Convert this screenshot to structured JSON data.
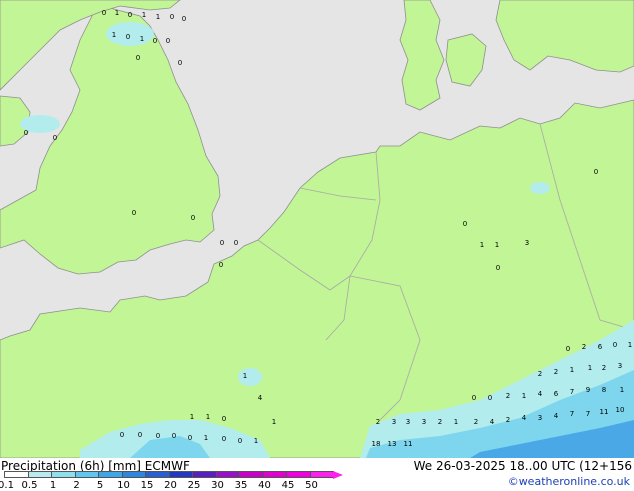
{
  "map": {
    "colors": {
      "sea": "#e5e5e5",
      "land": "#c1f595",
      "border": "#a8a8a8",
      "coast": "#8f8f8f",
      "light_precip": "#b3ecec",
      "medium_precip": "#7dd6ee",
      "heavy_precip": "#4aa8e6"
    },
    "station_values": [
      "0",
      "1",
      "0",
      "1",
      "1",
      "0",
      "0",
      "1",
      "0",
      "1",
      "0",
      "0",
      "0",
      "0",
      "0",
      "0",
      "0",
      "0",
      "0",
      "0",
      "0",
      "0",
      "1",
      "1",
      "3",
      "0",
      "0",
      "0",
      "2",
      "6",
      "0",
      "1",
      "4",
      "1",
      "1",
      "1",
      "0",
      "0",
      "0",
      "0",
      "0",
      "0",
      "1",
      "0",
      "0",
      "1",
      "1",
      "2",
      "3",
      "3",
      "3",
      "2",
      "1",
      "0",
      "0",
      "2",
      "1",
      "2",
      "2",
      "1",
      "1",
      "2",
      "3",
      "4",
      "6",
      "7",
      "9",
      "8",
      "1",
      "2",
      "4",
      "2",
      "4",
      "3",
      "4",
      "7",
      "7",
      "11",
      "10",
      "18",
      "13",
      "11"
    ]
  },
  "footer": {
    "title": "Precipitation (6h) [mm] ECMWF",
    "valid": "We 26-03-2025 18..00 UTC (12+156",
    "credit": "©weatheronline.co.uk",
    "legend_labels": [
      "0.1",
      "0.5",
      "1",
      "2",
      "5",
      "10",
      "15",
      "20",
      "25",
      "30",
      "35",
      "40",
      "45",
      "50"
    ],
    "legend_colors": [
      "#ffffff",
      "#b9eaf0",
      "#8ee0ee",
      "#60c8f0",
      "#3fa6ea",
      "#2f86e0",
      "#2a5fd4",
      "#2436c4",
      "#5a1fc0",
      "#9a10c8",
      "#c800c8",
      "#e000d0",
      "#f000e0",
      "#ff20f0"
    ]
  }
}
